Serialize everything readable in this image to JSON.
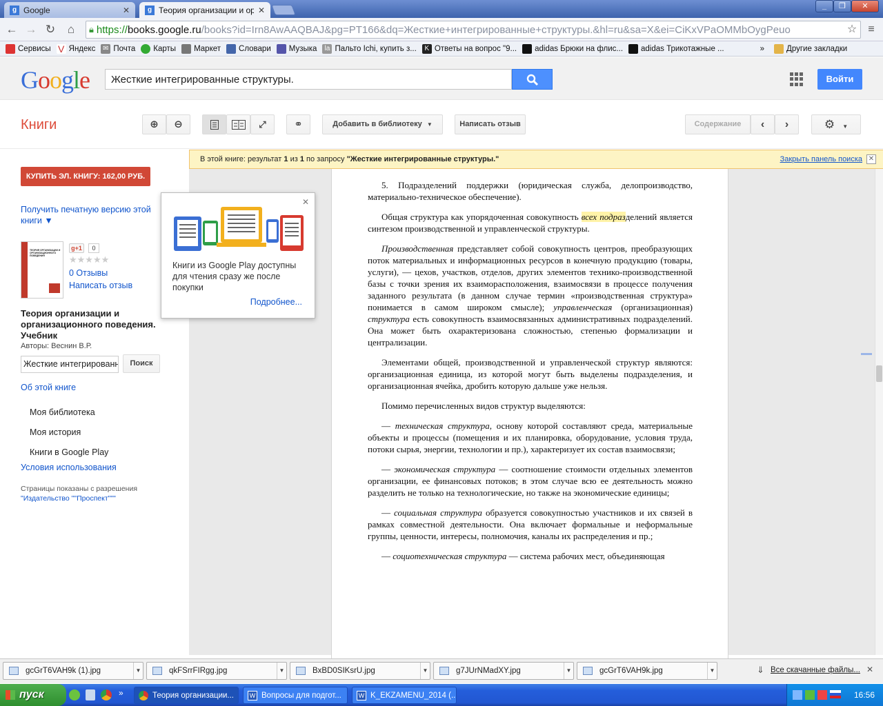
{
  "browser": {
    "tabs": [
      {
        "title": "Google",
        "favicon": "g"
      },
      {
        "title": "Теория организации и орга",
        "favicon": "g"
      }
    ],
    "window_controls": [
      "_",
      "❐",
      "✕"
    ],
    "url": {
      "scheme": "https://",
      "host": "books.google.ru",
      "rest": "/books?id=Irn8AwAAQBAJ&pg=PT166&dq=Жесткие+интегрированные+структуры.&hl=ru&sa=X&ei=CiKxVPaOMMbOygPeuo"
    },
    "bookmarks": [
      {
        "label": "Сервисы",
        "icon": "apps-icon",
        "color": "#d33"
      },
      {
        "label": "Яндекс",
        "icon": "yandex-icon",
        "color": "#c33"
      },
      {
        "label": "Почта",
        "icon": "mail-icon",
        "color": "#888"
      },
      {
        "label": "Карты",
        "icon": "maps-icon",
        "color": "#3a3"
      },
      {
        "label": "Маркет",
        "icon": "market-icon",
        "color": "#777"
      },
      {
        "label": "Словари",
        "icon": "dictionary-icon",
        "color": "#46a"
      },
      {
        "label": "Музыка",
        "icon": "music-icon",
        "color": "#55a"
      },
      {
        "label": "Пальто Ichi, купить з...",
        "icon": "lamoda-icon",
        "color": "#999"
      },
      {
        "label": "Ответы на вопрос \"9...",
        "icon": "answers-icon",
        "color": "#222"
      },
      {
        "label": "adidas Брюки на флис...",
        "icon": "adidas-icon",
        "color": "#111"
      },
      {
        "label": "adidas Трикотажные ...",
        "icon": "adidas-icon",
        "color": "#111"
      }
    ],
    "bookmarks_overflow": "»",
    "other_bookmarks": "Другие закладки"
  },
  "google": {
    "logo": "Google",
    "search_value": "Жесткие интегрированные структуры.",
    "signin_label": "Войти"
  },
  "books": {
    "title": "Книги",
    "add_to_library": "Добавить в библиотеку",
    "write_review": "Написать отзыв",
    "contents": "Содержание"
  },
  "result_bar": {
    "prefix": "В этой книге: результат",
    "index": "1",
    "of": "из",
    "total": "1",
    "query_prefix": "по запросу",
    "query": "\"Жесткие интегрированные структуры.\"",
    "close_label": "Закрыть панель поиска"
  },
  "sidebar": {
    "buy_label": "КУПИТЬ ЭЛ. КНИГУ: 162,00 РУБ.",
    "print_version": "Получить печатную версию этой книги ▼",
    "gplus": "g+1",
    "gplus_count": "0",
    "stars": "★★★★★",
    "reviews": "0 Отзывы",
    "write_review": "Написать отзыв",
    "book_title": "Теория организации и организационного поведения. Учебник",
    "authors": "Авторы: Веснин В.Р.",
    "inbook_search_value": "Жесткие интегрированн",
    "inbook_search_btn": "Поиск",
    "about": "Об этой книге",
    "menu": [
      "Моя библиотека",
      "Моя история",
      "Книги в Google Play"
    ],
    "terms": "Условия использования",
    "permission_text": "Страницы показаны с разрешения",
    "publisher": "\"Издательство \"\"Проспект\"\"\"",
    "cover_title": "ТЕОРИЯ ОРГАНИЗАЦИИ И ОРГАНИЗАЦИОННОГО ПОВЕДЕНИЯ"
  },
  "popup": {
    "text": "Книги из Google Play доступны для чтения сразу же после покупки",
    "more": "Подробнее..."
  },
  "page_text": {
    "p1": "5. Подразделений поддержки (юридическая служба, делопроизводство, материально-техническое обеспечение).",
    "p2a": "Общая структура как упорядоченная совокупность ",
    "p2hl": "всех подраз",
    "p2b": "делений является синтезом производственной и управленческой структуры.",
    "p3a_em": "Производственная",
    "p3a": " представляет собой совокупность центров, преобразующих поток материальных и информационных ресурсов в конечную продукцию (товары, услуги), — цехов, участков, отделов, других элементов технико-производственной базы с точки зрения их взаиморасположения, взаимосвязи в процессе получения заданного результата (в данном случае термин «производственная структура» понимается в самом широком смысле); ",
    "p3b_em": "управленческая",
    "p3b": " (организационная) ",
    "p3c_em": "структура",
    "p3c": " есть совокупность взаимосвязанных административных подразделений. Она может быть охарактеризована сложностью, степенью формализации и централизации.",
    "p4": "Элементами общей, производственной и управленческой структур являются: организационная единица, из которой могут быть выделены подразделения, и организационная ячейка, дробить которую дальше уже нельзя.",
    "p5": "Помимо перечисленных видов структур выделяются:",
    "p6_em": "техническая структура,",
    "p6": " основу которой составляют среда, материальные объекты и процессы (помещения и их планировка, оборудование, условия труда, потоки сырья, энергии, технологии и пр.), характеризует их состав взаимосвязи;",
    "p7_em": "экономическая структура",
    "p7": " — соотношение стоимости отдельных элементов организации, ее финансовых потоков; в этом случае всю ее деятельность можно разделить не только на технологические, но также на экономические единицы;",
    "p8_em": "социальная структура",
    "p8": " образуется совокупностью участников и их связей в рамках совместной деятельности. Она включает формальные и неформальные группы, ценности, интересы, полномочия, каналы их распределения и пр.;",
    "p9_em": "социотехническая структура",
    "p9": " — система рабочих мест, объединяющая",
    "dash": "— "
  },
  "downloads": {
    "files": [
      "gcGrT6VAH9k (1).jpg",
      "qkFSrrFIRgg.jpg",
      "BxBD0SIKsrU.jpg",
      "g7JUrNMadXY.jpg",
      "gcGrT6VAH9k.jpg"
    ],
    "all_downloads": "Все скачанные файлы..."
  },
  "taskbar": {
    "start": "пуск",
    "tasks": [
      "Теория организации...",
      "Вопросы для подгот...",
      "K_EKZAMENU_2014 (..."
    ],
    "clock": "16:56"
  }
}
